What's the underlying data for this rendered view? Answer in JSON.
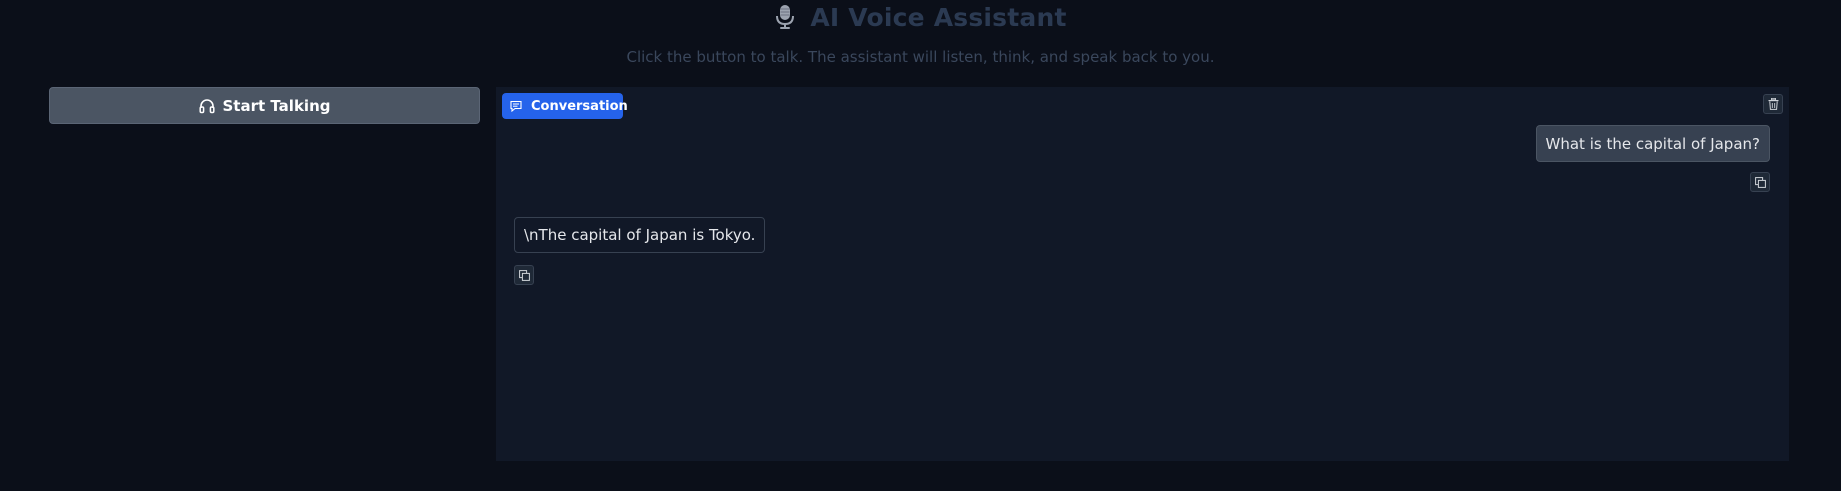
{
  "header": {
    "title": "AI Voice Assistant",
    "title_icon": "microphone-icon",
    "subtitle": "Click the button to talk. The assistant will listen, think, and speak back to you."
  },
  "controls": {
    "start_label": "Start Talking",
    "start_icon": "headphones-icon"
  },
  "chat": {
    "label": "Conversation",
    "label_icon": "chat-bubble-icon",
    "clear_icon": "trash-icon",
    "messages": [
      {
        "role": "user",
        "text": "What is the capital of Japan?"
      },
      {
        "role": "assistant",
        "text": "\\nThe capital of Japan is Tokyo."
      }
    ],
    "copy_icon": "copy-icon"
  },
  "colors": {
    "background": "#0b0f19",
    "panel": "#111827",
    "accent": "#2563eb",
    "button": "#4b5563",
    "title": "#2b3a52"
  }
}
